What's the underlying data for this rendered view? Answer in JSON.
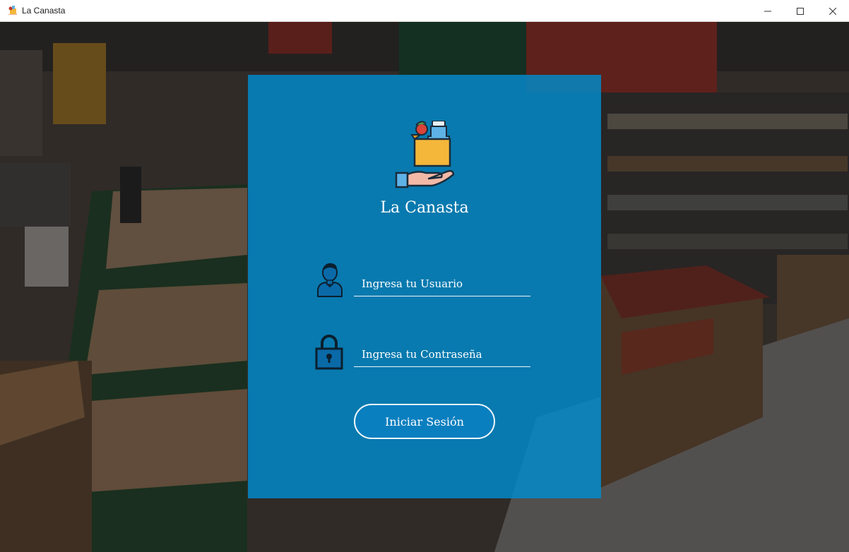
{
  "window": {
    "title": "La Canasta",
    "controls": {
      "minimize_icon": "minimize-icon",
      "maximize_icon": "maximize-icon",
      "close_icon": "close-icon"
    }
  },
  "login": {
    "brand": "La Canasta",
    "username": {
      "value": "",
      "placeholder": "Ingresa tu Usuario",
      "icon": "user-icon"
    },
    "password": {
      "value": "",
      "placeholder": "Ingresa tu Contraseña",
      "icon": "lock-icon"
    },
    "submit_label": "Iniciar Sesión",
    "logo_icon": "grocery-bag-hand-icon"
  },
  "colors": {
    "panel": "#008ccd",
    "button": "#0a7fbf",
    "text": "#ffffff"
  }
}
